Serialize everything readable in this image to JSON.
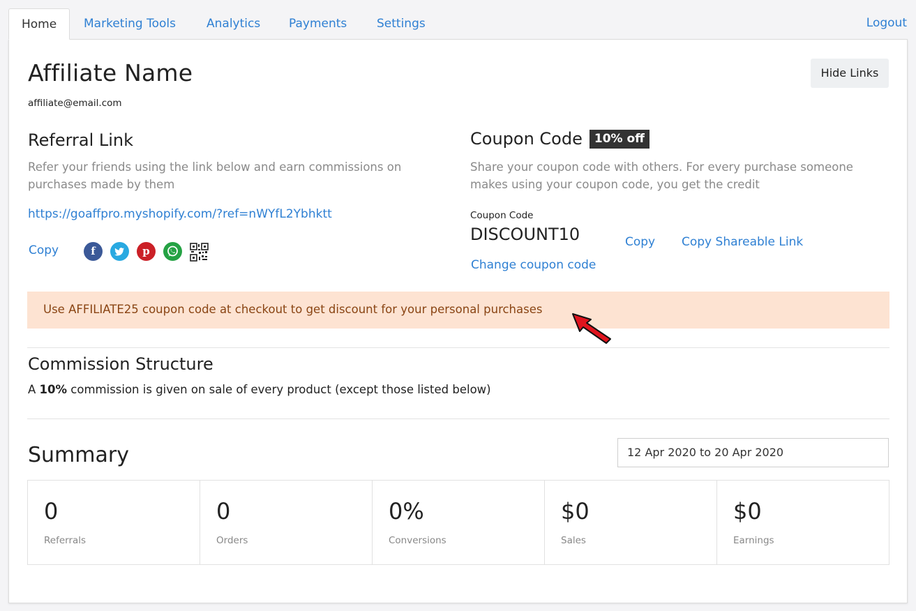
{
  "tabs": [
    {
      "label": "Home"
    },
    {
      "label": "Marketing Tools"
    },
    {
      "label": "Analytics"
    },
    {
      "label": "Payments"
    },
    {
      "label": "Settings"
    }
  ],
  "logout_label": "Logout",
  "profile": {
    "name": "Affiliate Name",
    "email": "affiliate@email.com",
    "hide_links_label": "Hide Links"
  },
  "referral": {
    "title": "Referral Link",
    "description": "Refer your friends using the link below and earn commissions on purchases made by them",
    "url": "https://goaffpro.myshopify.com/?ref=nWYfL2Ybhktt",
    "copy_label": "Copy",
    "share_icons": [
      "facebook-icon",
      "twitter-icon",
      "pinterest-icon",
      "whatsapp-icon",
      "qr-code-icon"
    ]
  },
  "coupon": {
    "title": "Coupon Code",
    "badge": "10% off",
    "description": "Share your coupon code with others. For every purchase someone makes using your coupon code, you get the credit",
    "field_label": "Coupon Code",
    "code": "DISCOUNT10",
    "copy_label": "Copy",
    "copy_shareable_label": "Copy Shareable Link",
    "change_label": "Change coupon code"
  },
  "alert": {
    "text": "Use AFFILIATE25 coupon code at checkout to get discount for your personal purchases"
  },
  "commission": {
    "title": "Commission Structure",
    "prefix": "A ",
    "rate": "10%",
    "suffix": " commission is given on sale of every product (except those listed below)"
  },
  "summary": {
    "title": "Summary",
    "date_range": "12 Apr 2020 to 20 Apr 2020",
    "stats": [
      {
        "value": "0",
        "label": "Referrals"
      },
      {
        "value": "0",
        "label": "Orders"
      },
      {
        "value": "0%",
        "label": "Conversions"
      },
      {
        "value": "$0",
        "label": "Sales"
      },
      {
        "value": "$0",
        "label": "Earnings"
      }
    ]
  },
  "colors": {
    "link": "#2f80d3",
    "alert_bg": "#fde3d2",
    "alert_text": "#8a4514",
    "badge_bg": "#333333",
    "arrow": "#e0141e"
  }
}
